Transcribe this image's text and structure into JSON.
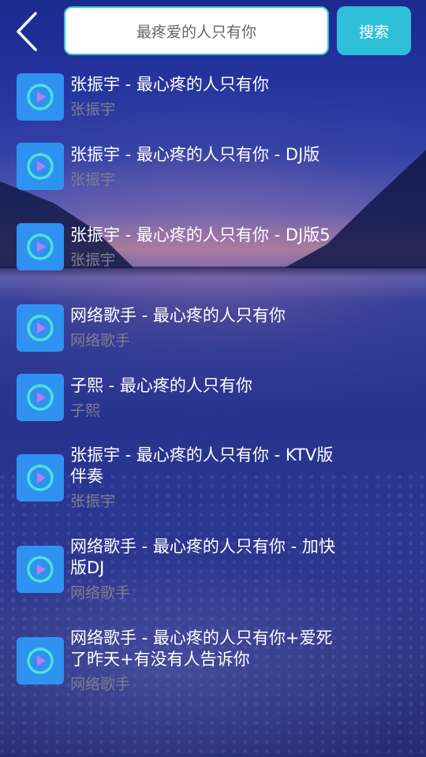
{
  "header": {
    "back_icon": "chevron-left-icon",
    "search_value": "最疼爱的人只有你",
    "search_button_label": "搜索"
  },
  "songs": [
    {
      "title": "张振宇 - 最心疼的人只有你",
      "artist": "张振宇"
    },
    {
      "title": "张振宇 - 最心疼的人只有你 - DJ版",
      "artist": "张振宇"
    },
    {
      "title": "张振宇 - 最心疼的人只有你 - DJ版5",
      "artist": "张振宇"
    },
    {
      "title": "网络歌手 - 最心疼的人只有你",
      "artist": "网络歌手"
    },
    {
      "title": "子熙 - 最心疼的人只有你",
      "artist": "子熙"
    },
    {
      "title": "张振宇 - 最心疼的人只有你 - KTV版伴奏",
      "artist": "张振宇"
    },
    {
      "title": "网络歌手 - 最心疼的人只有你 - 加快版DJ",
      "artist": "网络歌手"
    },
    {
      "title": "网络歌手 - 最心疼的人只有你+爱死了昨天+有没有人告诉你",
      "artist": "网络歌手"
    }
  ],
  "colors": {
    "accent": "#2fbfd9",
    "icon_bg": "#2f92f0",
    "icon_play": "#4fe0d8",
    "artist_text": "#7e7e8e"
  },
  "icons": {
    "item_icon": "play-icon"
  }
}
